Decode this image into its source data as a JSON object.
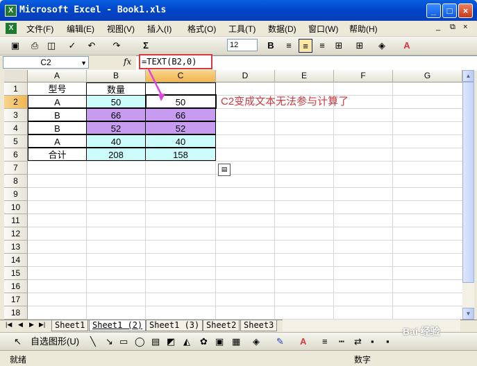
{
  "window": {
    "title": "Microsoft Excel - Book1.xls"
  },
  "menu": [
    "文件(F)",
    "编辑(E)",
    "视图(V)",
    "插入(I)",
    "格式(O)",
    "工具(T)",
    "数据(D)",
    "窗口(W)",
    "帮助(H)"
  ],
  "toolbar": {
    "font_size": "12",
    "sum_symbol": "Σ"
  },
  "formula_bar": {
    "name_box": "C2",
    "fx": "fx",
    "formula": "=TEXT(B2,0)"
  },
  "columns": [
    "A",
    "B",
    "C",
    "D",
    "E",
    "F",
    "G"
  ],
  "rows": [
    "1",
    "2",
    "3",
    "4",
    "5",
    "6",
    "7",
    "8",
    "9",
    "10",
    "11",
    "12",
    "13",
    "14",
    "15",
    "16",
    "17",
    "18"
  ],
  "table": {
    "headers": [
      "型号",
      "数量",
      ""
    ],
    "rows": [
      [
        "A",
        "50",
        "50"
      ],
      [
        "B",
        "66",
        "66"
      ],
      [
        "B",
        "52",
        "52"
      ],
      [
        "A",
        "40",
        "40"
      ],
      [
        "合计",
        "208",
        "158"
      ]
    ]
  },
  "annotation": "C2变成文本无法参与计算了",
  "sheets": [
    "Sheet1",
    "Sheet1 (2)",
    "Sheet1 (3)",
    "Sheet2",
    "Sheet3"
  ],
  "drawing": {
    "autoshapes_label": "自选图形(U)"
  },
  "status": {
    "ready": "就绪",
    "mode": "数字"
  },
  "watermark": "Bai 经验",
  "colors": {
    "cyan": "#cdfcfc",
    "purple": "#c69bf0",
    "annotation": "#d9363e"
  }
}
